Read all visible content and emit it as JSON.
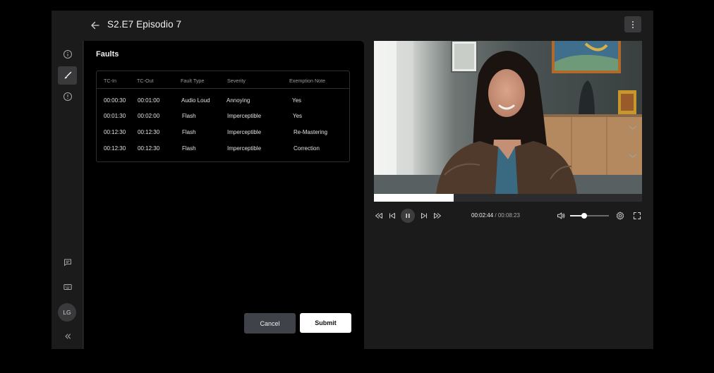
{
  "header": {
    "title": "S2.E7 Episodio 7"
  },
  "rail": {
    "top_icons": [
      "info-icon",
      "brush-icon",
      "alert-icon"
    ],
    "bottom_icons": [
      "comment-icon",
      "keyboard-icon"
    ],
    "avatar_initials": "LG",
    "collapse_icon": "double-chevron-left-icon"
  },
  "faults": {
    "title": "Faults",
    "columns": [
      "TC-In",
      "TC-Out",
      "Fault Type",
      "Severity",
      "Exemption Note"
    ],
    "rows": [
      [
        "00:00:30",
        "00:01:00",
        "Audio Loud",
        "Annoying",
        "Yes"
      ],
      [
        "00:01:30",
        "00:02:00",
        "Flash",
        "Imperceptible",
        "Yes"
      ],
      [
        "00:12:30",
        "00:12:30",
        "Flash",
        "Imperceptible",
        "Re-Mastering"
      ],
      [
        "00:12:30",
        "00:12:30",
        "Flash",
        "Imperceptible",
        "Correction"
      ]
    ]
  },
  "actions": {
    "cancel": "Cancel",
    "submit": "Submit"
  },
  "player": {
    "current_time": "00:02:44",
    "separator": "/",
    "duration": "00:08:23",
    "progress_fraction": 0.298,
    "volume_fraction": 0.36
  },
  "colors": {
    "accent": "#ffffff",
    "panel": "#000000",
    "chrome": "#1b1b1c"
  }
}
